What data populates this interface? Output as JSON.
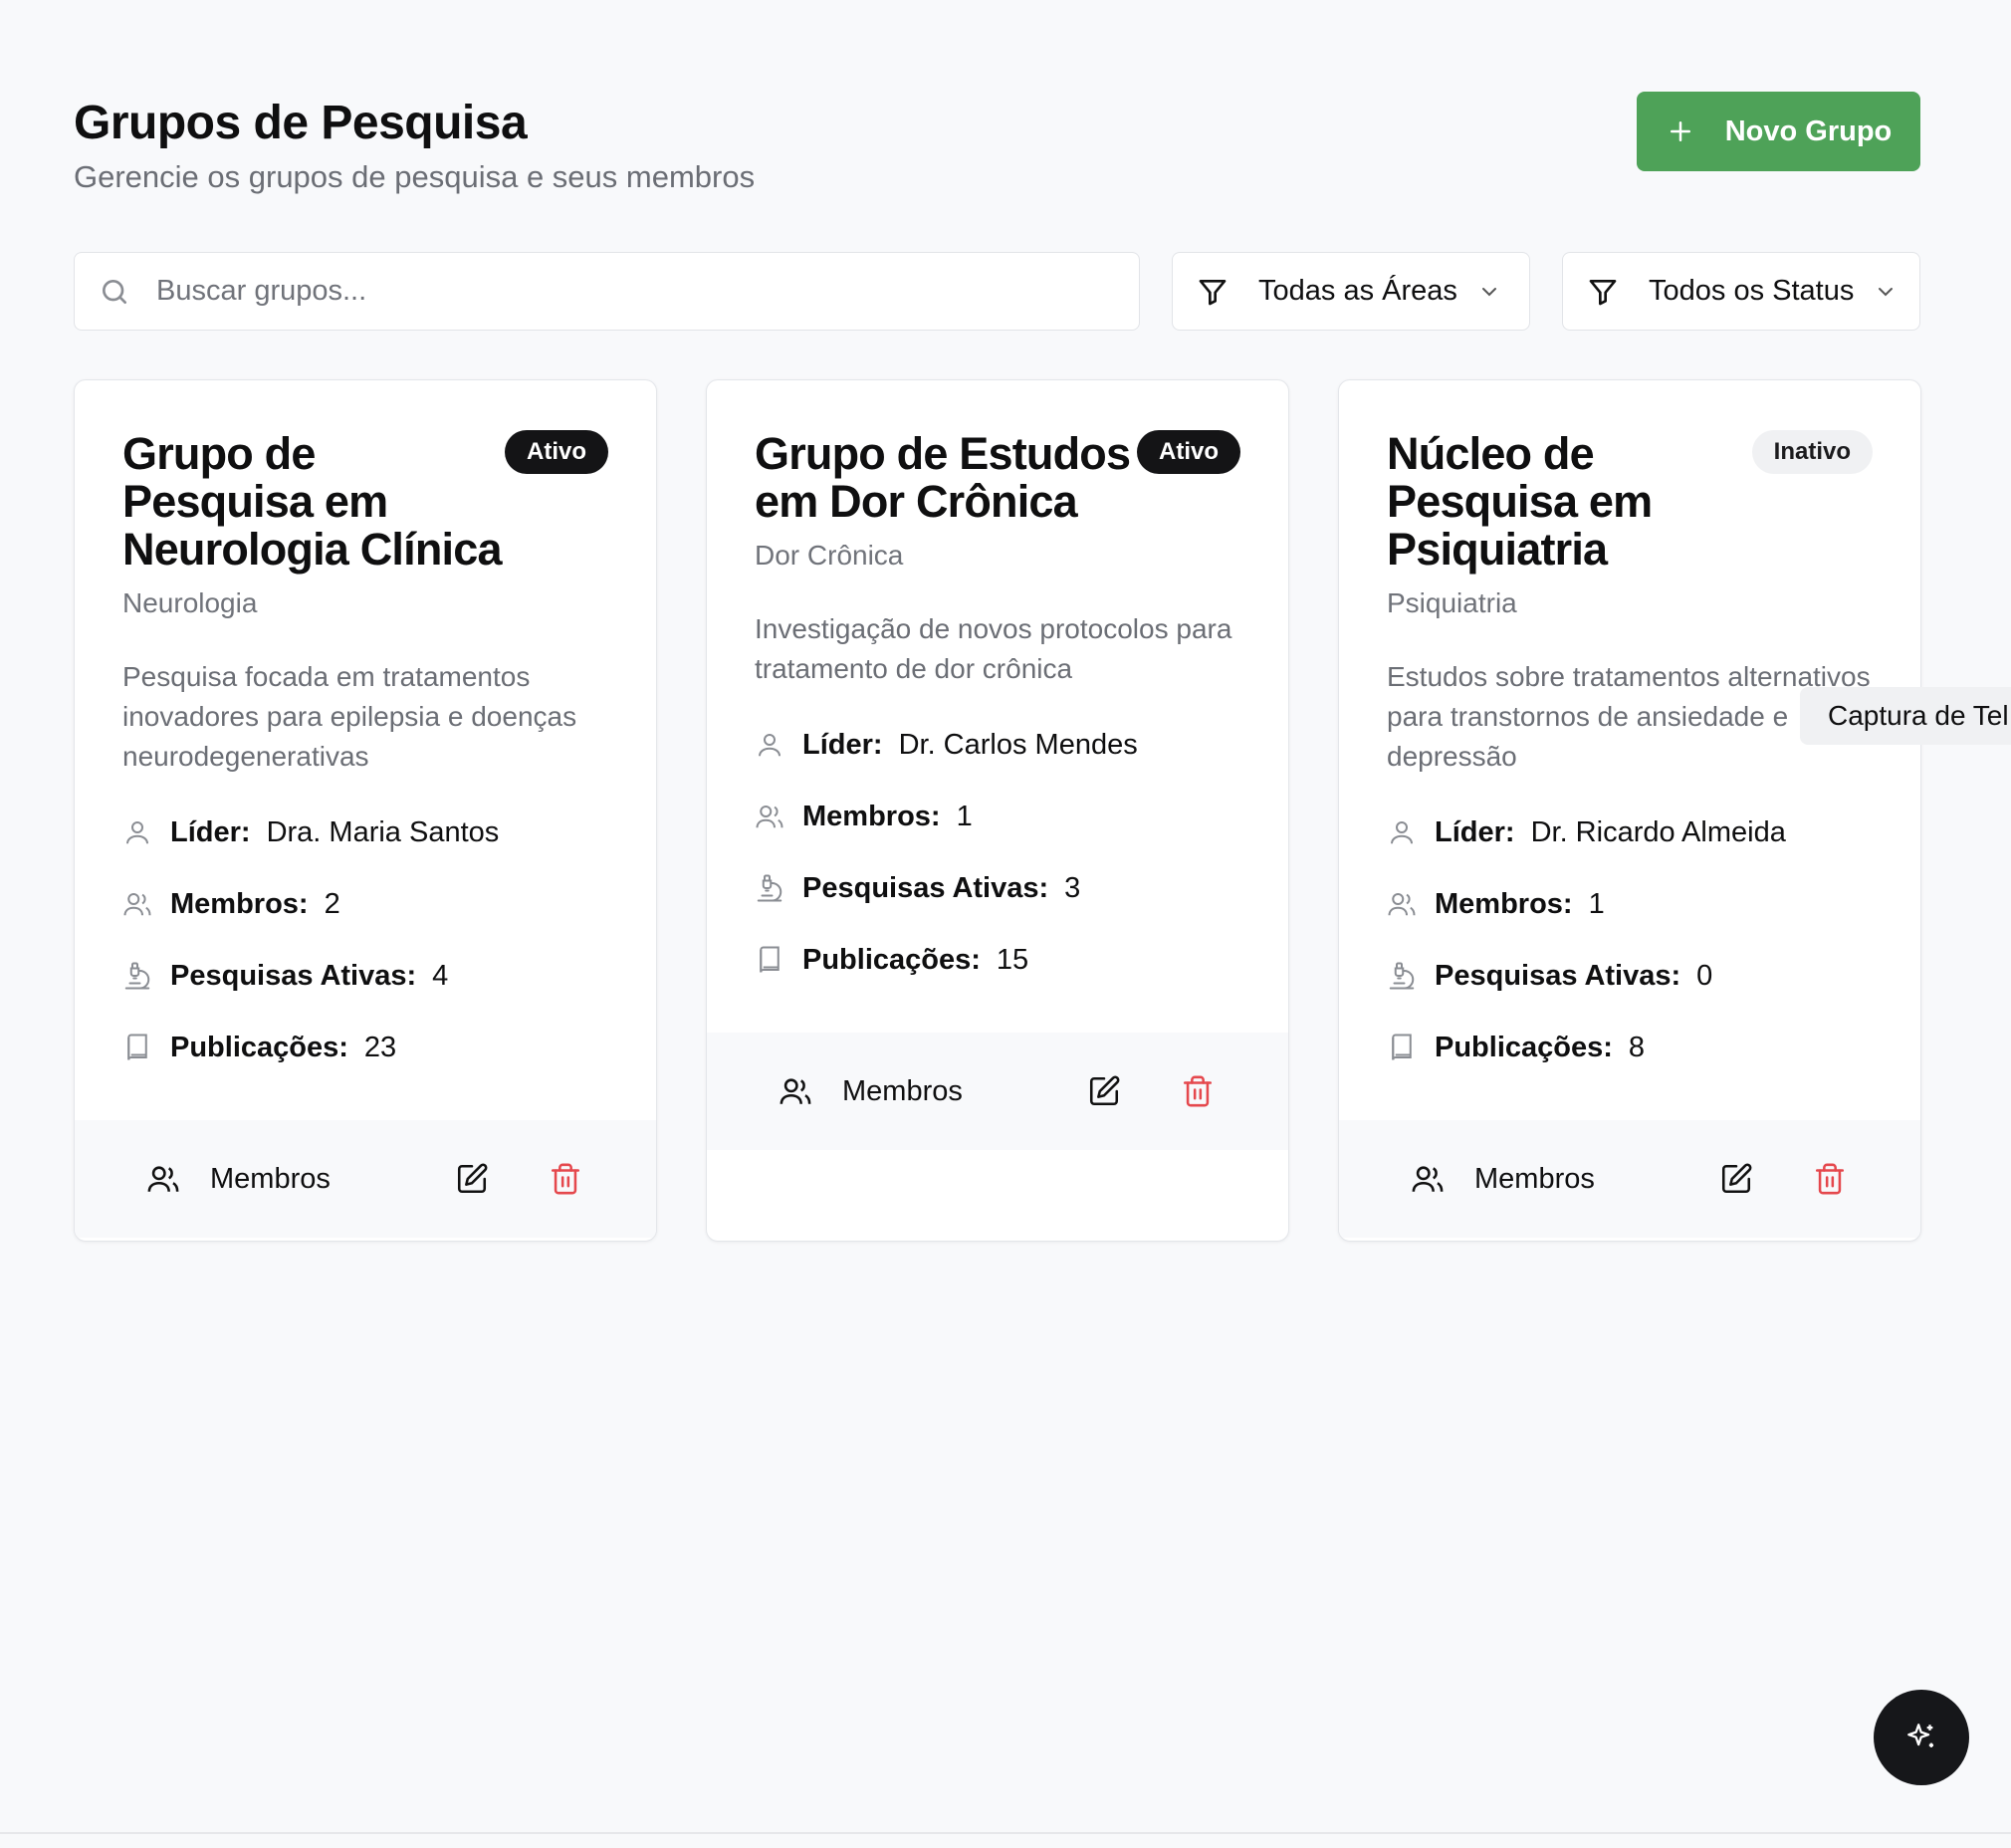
{
  "header": {
    "title": "Grupos de Pesquisa",
    "subtitle": "Gerencie os grupos de pesquisa e seus membros",
    "new_group_label": "Novo Grupo"
  },
  "filters": {
    "search_placeholder": "Buscar grupos...",
    "search_value": "",
    "area_selected": "Todas as Áreas",
    "status_selected": "Todos os Status"
  },
  "labels": {
    "leader": "Líder:",
    "members": "Membros:",
    "active_research": "Pesquisas Ativas:",
    "publications": "Publicações:",
    "members_button": "Membros"
  },
  "groups": [
    {
      "title": "Grupo de Pesquisa em Neurologia Clínica",
      "status": "Ativo",
      "area": "Neurologia",
      "description": "Pesquisa focada em tratamentos inovadores para epilepsia e doenças neurodegenerativas",
      "leader": "Dra. Maria Santos",
      "members": "2",
      "active_research": "4",
      "publications": "23"
    },
    {
      "title": "Grupo de Estudos em Dor Crônica",
      "status": "Ativo",
      "area": "Dor Crônica",
      "description": "Investigação de novos protocolos para tratamento de dor crônica",
      "leader": "Dr. Carlos Mendes",
      "members": "1",
      "active_research": "3",
      "publications": "15"
    },
    {
      "title": "Núcleo de Pesquisa em Psiquiatria",
      "status": "Inativo",
      "area": "Psiquiatria",
      "description": "Estudos sobre tratamentos alternativos para transtornos de ansiedade e depressão",
      "leader": "Dr. Ricardo Almeida",
      "members": "1",
      "active_research": "0",
      "publications": "8"
    }
  ],
  "tooltip": {
    "text": "Captura de Tel"
  },
  "colors": {
    "primary_green": "#4ea258",
    "badge_active": "#141416",
    "badge_inactive": "#f0f1f3",
    "delete_red": "#e5484d"
  }
}
